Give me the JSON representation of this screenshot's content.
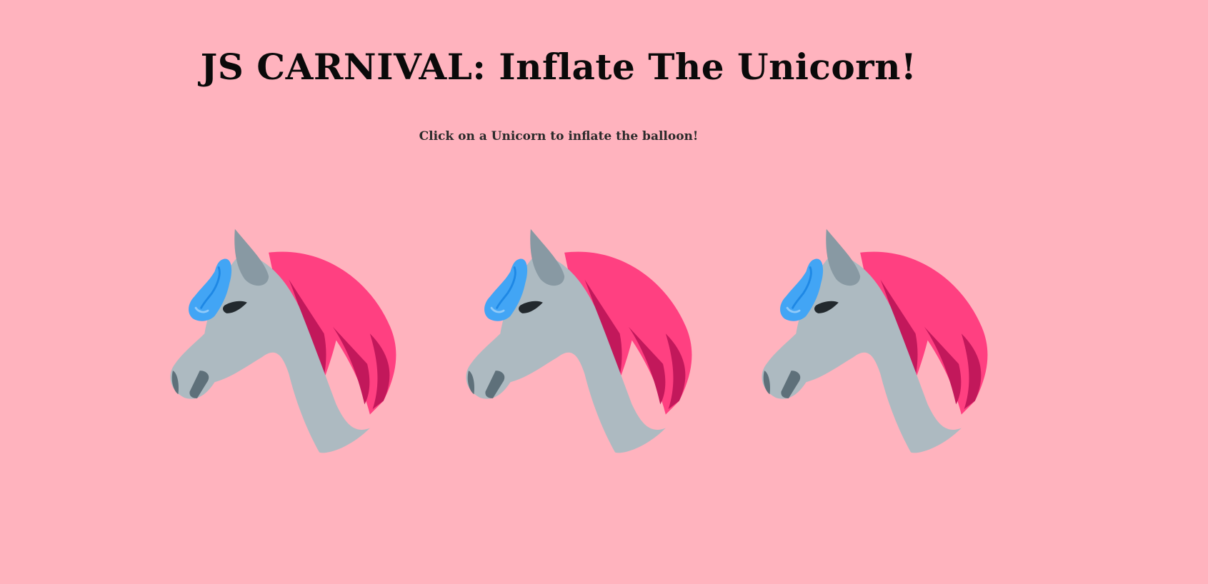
{
  "page": {
    "title": "JS CARNIVAL: Inflate The Unicorn!",
    "instructions": "Click on a Unicorn to inflate the balloon!",
    "background_color": "#ffb3be"
  },
  "unicorns": [
    {
      "icon": "unicorn-head-icon",
      "balloon_icon": "balloon-icon",
      "mane_color": "#ff4081",
      "head_color": "#adbac1",
      "balloon_color": "#42a5f5"
    },
    {
      "icon": "unicorn-head-icon",
      "balloon_icon": "balloon-icon",
      "mane_color": "#ff4081",
      "head_color": "#adbac1",
      "balloon_color": "#42a5f5"
    },
    {
      "icon": "unicorn-head-icon",
      "balloon_icon": "balloon-icon",
      "mane_color": "#ff4081",
      "head_color": "#adbac1",
      "balloon_color": "#42a5f5"
    }
  ]
}
